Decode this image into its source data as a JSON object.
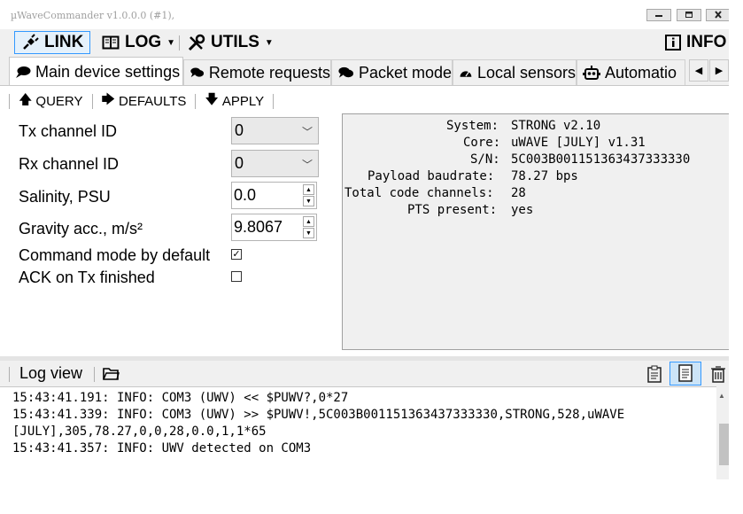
{
  "window": {
    "title": "µWaveCommander v1.0.0.0 (#1),",
    "buttons": [
      "minimize-icon",
      "restore-icon",
      "close-icon"
    ]
  },
  "toolbar": {
    "link": "LINK",
    "log": "LOG",
    "utils": "UTILS",
    "info": "INFO"
  },
  "tabs": {
    "main": "Main device settings",
    "remote": "Remote requests",
    "packet": "Packet mode",
    "sensors": "Local sensors",
    "automation": "Automatio"
  },
  "actions": {
    "query": "QUERY",
    "defaults": "DEFAULTS",
    "apply": "APPLY"
  },
  "settings": {
    "tx_label": "Tx channel ID",
    "tx_value": "0",
    "rx_label": "Rx channel ID",
    "rx_value": "0",
    "salinity_label": "Salinity, PSU",
    "salinity_value": "0.0",
    "gravity_label": "Gravity acc., m/s²",
    "gravity_value": "9.8067",
    "command_mode_label": "Command mode by default",
    "command_mode_checked": true,
    "ack_label": "ACK on Tx finished",
    "ack_checked": false
  },
  "info": {
    "rows": [
      {
        "key": "System:",
        "value": "STRONG v2.10"
      },
      {
        "key": "Core:",
        "value": "uWAVE [JULY] v1.31"
      },
      {
        "key": "S/N:",
        "value": "5C003B001151363437333330"
      },
      {
        "key": "Payload baudrate:",
        "value": "78.27 bps"
      },
      {
        "key": "Total code channels:",
        "value": "28"
      },
      {
        "key": "PTS present:",
        "value": "yes"
      }
    ]
  },
  "log": {
    "title": "Log view",
    "lines": [
      "15:43:41.191: INFO: COM3 (UWV) << $PUWV?,0*27",
      "15:43:41.339: INFO: COM3 (UWV) >> $PUWV!,5C003B001151363437333330,STRONG,528,uWAVE",
      "[JULY],305,78.27,0,0,28,0.0,1,1*65",
      "15:43:41.357: INFO: UWV detected on COM3"
    ]
  }
}
